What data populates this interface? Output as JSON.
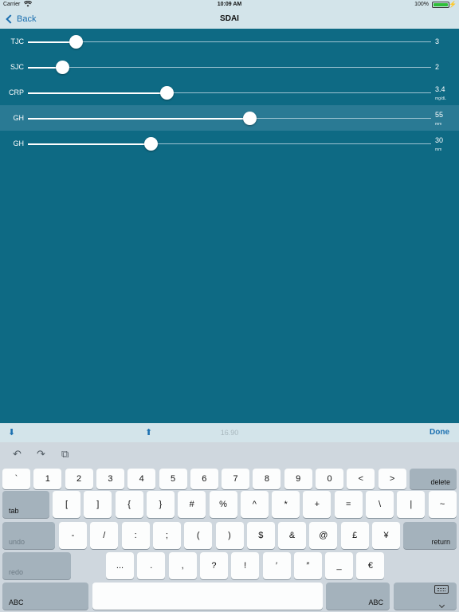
{
  "status_bar": {
    "carrier": "Carrier",
    "time": "10:09 AM",
    "battery": "100%"
  },
  "nav": {
    "back_label": "Back",
    "title": "SDAI"
  },
  "sliders": [
    {
      "label": "TJC",
      "value": "3",
      "unit": "",
      "fraction": 0.12,
      "selected": false
    },
    {
      "label": "SJC",
      "value": "2",
      "unit": "",
      "fraction": 0.085,
      "selected": false
    },
    {
      "label": "CRP",
      "value": "3.4",
      "unit": "mg/dL",
      "fraction": 0.345,
      "selected": false
    },
    {
      "label": "GH",
      "value": "55",
      "unit": "mm",
      "fraction": 0.55,
      "selected": true
    },
    {
      "label": "GH",
      "value": "30",
      "unit": "mm",
      "fraction": 0.305,
      "selected": false
    }
  ],
  "accessory": {
    "down_icon": "⬇",
    "up_icon": "⬆",
    "value": "16.90",
    "done_label": "Done"
  },
  "keyboard": {
    "tools": [
      "↶",
      "↷",
      "⧉"
    ],
    "row1": [
      "`",
      "1",
      "2",
      "3",
      "4",
      "5",
      "6",
      "7",
      "8",
      "9",
      "0",
      "<",
      ">"
    ],
    "delete_label": "delete",
    "tab_label": "tab",
    "row2": [
      "[",
      "]",
      "{",
      "}",
      "#",
      "%",
      "^",
      "*",
      "+",
      "=",
      "\\",
      "|",
      "~"
    ],
    "undo_label": "undo",
    "row3": [
      "-",
      "/",
      ":",
      ";",
      "(",
      ")",
      "$",
      "&",
      "@",
      "£",
      "¥"
    ],
    "return_label": "return",
    "redo_label": "redo",
    "row4": [
      "...",
      ".",
      ",",
      "?",
      "!",
      "′",
      "″",
      "_",
      "€"
    ],
    "abc_left_label": "ABC",
    "abc_right_label": "ABC"
  },
  "colors": {
    "background": "#0e6a84",
    "bar": "#d3e4ea",
    "accent": "#1a6fb0"
  }
}
